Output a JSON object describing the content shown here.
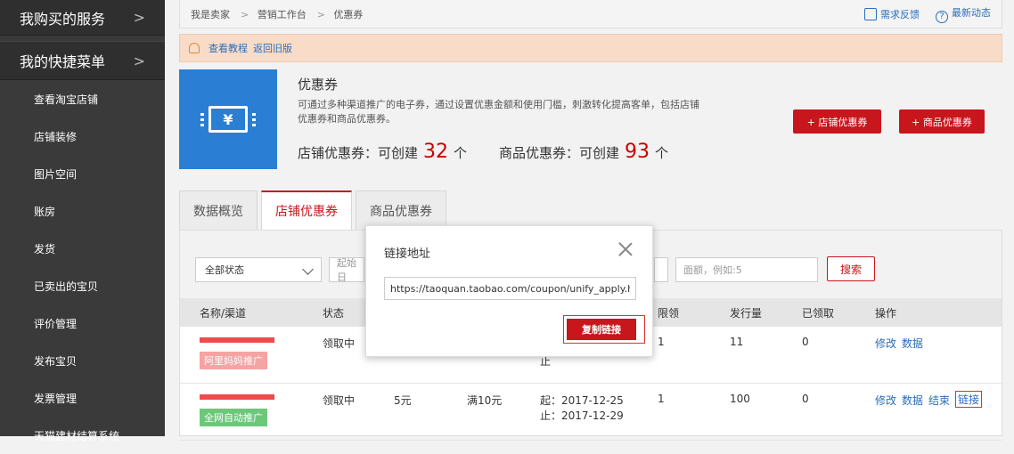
{
  "sidebar": {
    "section1": "我购买的服务",
    "section2": "我的快捷菜单",
    "items": [
      "查看淘宝店铺",
      "店铺装修",
      "图片空间",
      "账房",
      "发货",
      "已卖出的宝贝",
      "评价管理",
      "发布宝贝",
      "发票管理",
      "天猫建材结算系统"
    ]
  },
  "breadcrumb": [
    "我是卖家",
    "营销工作台",
    "优惠券"
  ],
  "topright": {
    "feedback": "需求反馈",
    "news": "最新动态"
  },
  "notice": {
    "tutorial": "查看教程",
    "back": "返回旧版"
  },
  "coupon": {
    "title": "优惠券",
    "desc": "可通过多种渠道推广的电子券，通过设置优惠金额和使用门槛，刺激转化提高客单，包括店铺优惠券和商品优惠券。",
    "shop_label": "店铺优惠券：可创建",
    "shop_count": "32",
    "item_label": "商品优惠券：可创建",
    "item_count": "93",
    "unit": "个",
    "btn_shop": "+ 店铺优惠券",
    "btn_item": "+ 商品优惠券"
  },
  "tabs": [
    "数据概览",
    "店铺优惠券",
    "商品优惠券"
  ],
  "filters": {
    "status": "全部状态",
    "start_placeholder": "起始日",
    "amount_placeholder": "面额，例如:5",
    "search": "搜索"
  },
  "table": {
    "headers": {
      "name": "名称/渠道",
      "status": "状态",
      "limit": "限领",
      "issued": "发行量",
      "claimed": "已领取",
      "ops": "操作"
    },
    "rows": [
      {
        "status": "领取中",
        "tag": "阿里妈妈推广",
        "date": "止",
        "limit": "1",
        "issued": "11",
        "claimed": "0",
        "ops": [
          "修改",
          "数据"
        ]
      },
      {
        "status": "领取中",
        "amount": "5元",
        "threshold": "满10元",
        "start": "起：2017-12-25",
        "end": "止：2017-12-29",
        "tag": "全网自动推广",
        "limit": "1",
        "issued": "100",
        "claimed": "0",
        "ops": [
          "修改",
          "数据",
          "结束",
          "链接"
        ]
      }
    ]
  },
  "modal": {
    "title": "链接地址",
    "url": "https://taoquan.taobao.com/coupon/unify_apply.htm?",
    "copy": "复制链接"
  }
}
